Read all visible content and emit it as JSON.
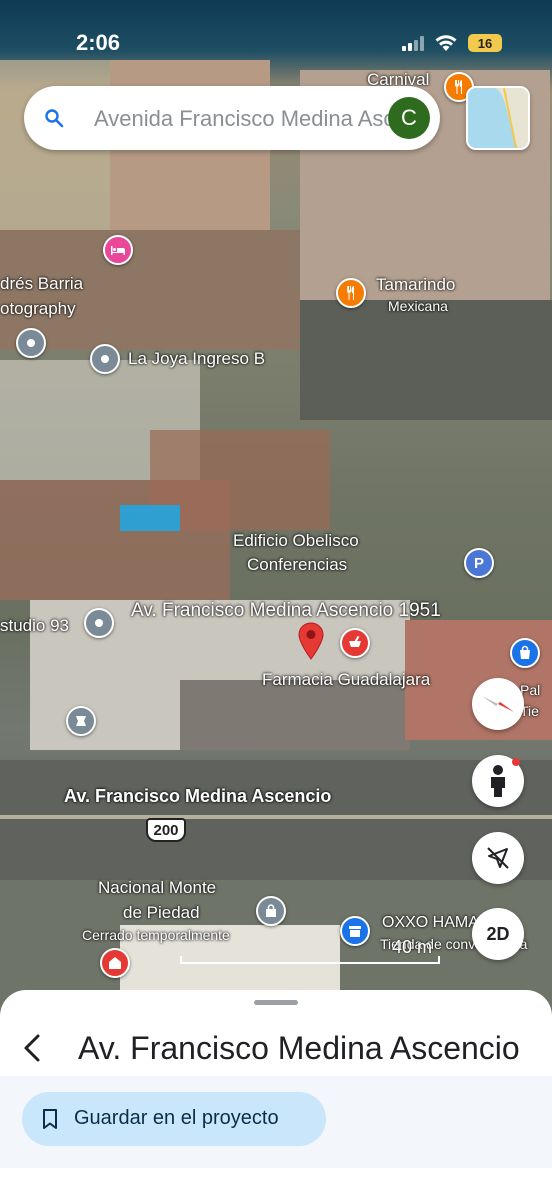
{
  "status_bar": {
    "time": "2:06",
    "battery": "16"
  },
  "search": {
    "value": "Avenida Francisco Medina Ascencio",
    "avatar_letter": "C"
  },
  "map": {
    "labels": {
      "carnival": "Carnival",
      "tamarindo": "Tamarindo",
      "tamarindo_sub": "Mexicana",
      "andres": "drés Barria",
      "andres2": "otography",
      "la_joya": "La Joya Ingreso B",
      "edificio": "Edificio Obelisco",
      "edificio2": "Conferencias",
      "address": "Av. Francisco Medina Ascencio 1951",
      "studio": "studio 93",
      "farmacia": "Farmacia Guadalajara",
      "road": "Av. Francisco Medina Ascencio",
      "route": "200",
      "nacional": "Nacional Monte",
      "nacional2": "de Piedad",
      "nacional_status": "Cerrado temporalmente",
      "oxxo": "OXXO HAMACO",
      "oxxo_sub": "Tienda de conveniencia",
      "pal": "Pal",
      "pal_sub": "Tie",
      "p": "P"
    },
    "scale": "40 m",
    "view_toggle": "2D"
  },
  "sheet": {
    "title": "Av. Francisco Medina Ascencio",
    "save_label": "Guardar en el proyecto"
  },
  "colors": {
    "accent": "#1a73e8",
    "food_pin": "#f57c00",
    "hotel_pin": "#e8479a",
    "pharmacy_pin": "#e53935",
    "poi_gray": "#7a8a96",
    "save_bg": "#c9e6fb"
  }
}
